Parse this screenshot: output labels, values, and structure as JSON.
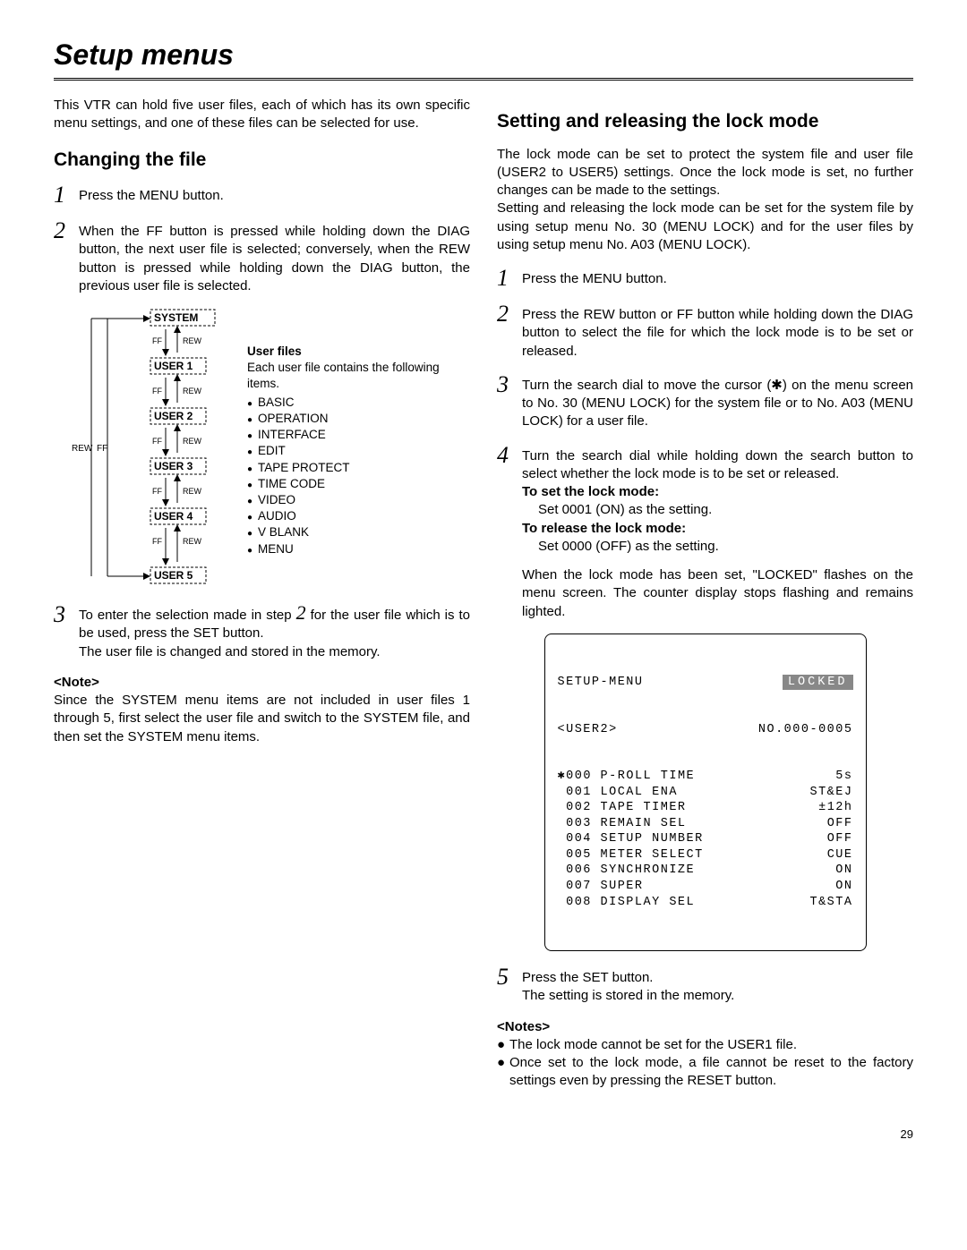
{
  "page_title": "Setup menus",
  "page_number": "29",
  "left": {
    "intro": "This VTR can hold five user files, each of which has its own specific menu settings, and one of these files can be selected for use.",
    "section_title": "Changing the file",
    "step1": "Press the MENU button.",
    "step2": "When the FF button is pressed while holding down the DIAG button, the next user file is selected; conversely, when the REW button is pressed while holding down the DIAG button, the previous user file is selected.",
    "diagram": {
      "rew": "REW",
      "ff": "FF",
      "system": "SYSTEM",
      "user1": "USER 1",
      "user2": "USER 2",
      "user3": "USER 3",
      "user4": "USER 4",
      "user5": "USER 5",
      "userfiles_title": "User files",
      "userfiles_desc": "Each user file contains the following items.",
      "items": [
        "BASIC",
        "OPERATION",
        "INTERFACE",
        "EDIT",
        "TAPE PROTECT",
        "TIME CODE",
        "VIDEO",
        "AUDIO",
        "V BLANK",
        "MENU"
      ]
    },
    "step3_a": "To enter the selection made in step ",
    "step3_b": " for the user file which is to be used, press the SET button.",
    "step3_c": "The user file is changed and stored in the memory.",
    "note_title": "<Note>",
    "note_body": "Since the SYSTEM menu items are not included in user files 1 through 5, first select the user file and switch to the SYSTEM file, and then set the SYSTEM menu items."
  },
  "right": {
    "section_title": "Setting and releasing the lock mode",
    "intro1": "The lock mode can be set to protect the system file and user file (USER2 to USER5) settings. Once the lock mode is set, no further changes can be made to the settings.",
    "intro2": "Setting and releasing the lock mode can be set for the system file by using setup menu No. 30 (MENU LOCK) and for the user files by using setup menu No. A03 (MENU LOCK).",
    "step1": "Press the MENU button.",
    "step2": "Press the REW button or FF button while holding down the DIAG button to select the file for which the lock mode is to be set or released.",
    "step3": "Turn the search dial to move the cursor (✱) on the menu screen to No. 30 (MENU LOCK) for the system file or to No. A03 (MENU LOCK) for a user file.",
    "step4_a": "Turn the search dial while holding down the search button to select whether the lock mode is to be set or released.",
    "step4_set_title": "To set the lock mode:",
    "step4_set_body": "Set 0001 (ON) as the setting.",
    "step4_rel_title": "To release the lock mode:",
    "step4_rel_body": "Set 0000 (OFF) as the setting.",
    "step4_result": "When the lock mode has been set, \"LOCKED\" flashes on the menu screen. The counter display stops flashing and remains lighted.",
    "menu": {
      "title": "SETUP-MENU",
      "locked": "LOCKED",
      "user_line_left": "<USER2>",
      "user_line_right": "NO.000-0005",
      "rows": [
        {
          "cursor": "✱",
          "no": "000",
          "name": "P-ROLL TIME",
          "val": "5s"
        },
        {
          "cursor": " ",
          "no": "001",
          "name": "LOCAL ENA",
          "val": "ST&EJ"
        },
        {
          "cursor": " ",
          "no": "002",
          "name": "TAPE TIMER",
          "val": "±12h"
        },
        {
          "cursor": " ",
          "no": "003",
          "name": "REMAIN SEL",
          "val": "OFF"
        },
        {
          "cursor": " ",
          "no": "004",
          "name": "SETUP NUMBER",
          "val": "OFF"
        },
        {
          "cursor": " ",
          "no": "005",
          "name": "METER SELECT",
          "val": "CUE"
        },
        {
          "cursor": " ",
          "no": "006",
          "name": "SYNCHRONIZE",
          "val": "ON"
        },
        {
          "cursor": " ",
          "no": "007",
          "name": "SUPER",
          "val": "ON"
        },
        {
          "cursor": " ",
          "no": "008",
          "name": "DISPLAY SEL",
          "val": "T&STA"
        }
      ]
    },
    "step5_a": "Press the SET button.",
    "step5_b": "The setting is stored in the memory.",
    "notes_title": "<Notes>",
    "note1": "The lock mode cannot be set for the USER1 file.",
    "note2": "Once set to the lock mode, a file cannot be reset to the factory settings even by pressing the RESET button."
  }
}
